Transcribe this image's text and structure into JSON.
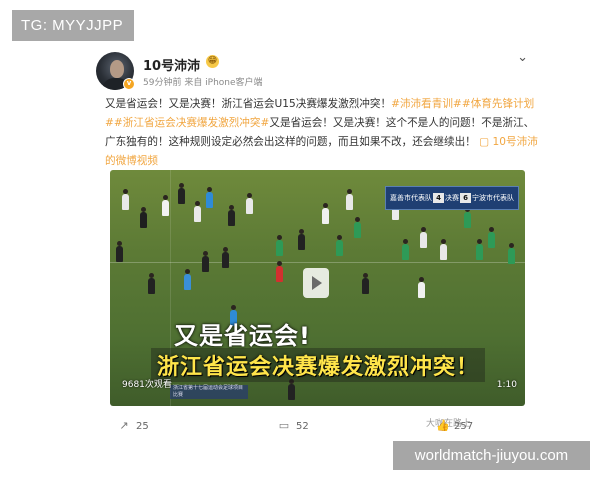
{
  "overlay": {
    "tg_label": "TG: MYYJJPP",
    "site_label": "worldmatch-jiuyou.com"
  },
  "post": {
    "username": "10号沛沛",
    "user_emoji": "😁",
    "meta": "59分钟前 来自 iPhone客户端",
    "text_1": "又是省运会！又是决赛！浙江省运会U15决赛爆发激烈冲突！",
    "tag_1": "#沛沛看青训#",
    "tag_2": "#体育先锋计划#",
    "tag_3": "#浙江省运会决赛爆发激烈冲突#",
    "text_2": "又是省运会！又是决赛！这个不是人的问题！不是浙江、广东独有的！这种规则设定必然会出这样的问题，而且如果不改，还会继续出！",
    "link_label": "10号沛沛的微博视频"
  },
  "video": {
    "caption_1": "又是省运会!",
    "caption_2": "浙江省运会决赛爆发激烈冲突！",
    "view_count": "9681次观看",
    "duration": "1:10",
    "scoreboard": {
      "team_left": "嘉善市代表队",
      "score_left": "4",
      "score_right": "6",
      "team_right": "宁波市代表队",
      "label": "决赛"
    },
    "subtitle_text": "浙江省第十七届运动会足球项目比赛"
  },
  "actions": {
    "share_count": "25",
    "comment_count": "52",
    "like_count": "257"
  },
  "watermark_user": "大咖在路上"
}
